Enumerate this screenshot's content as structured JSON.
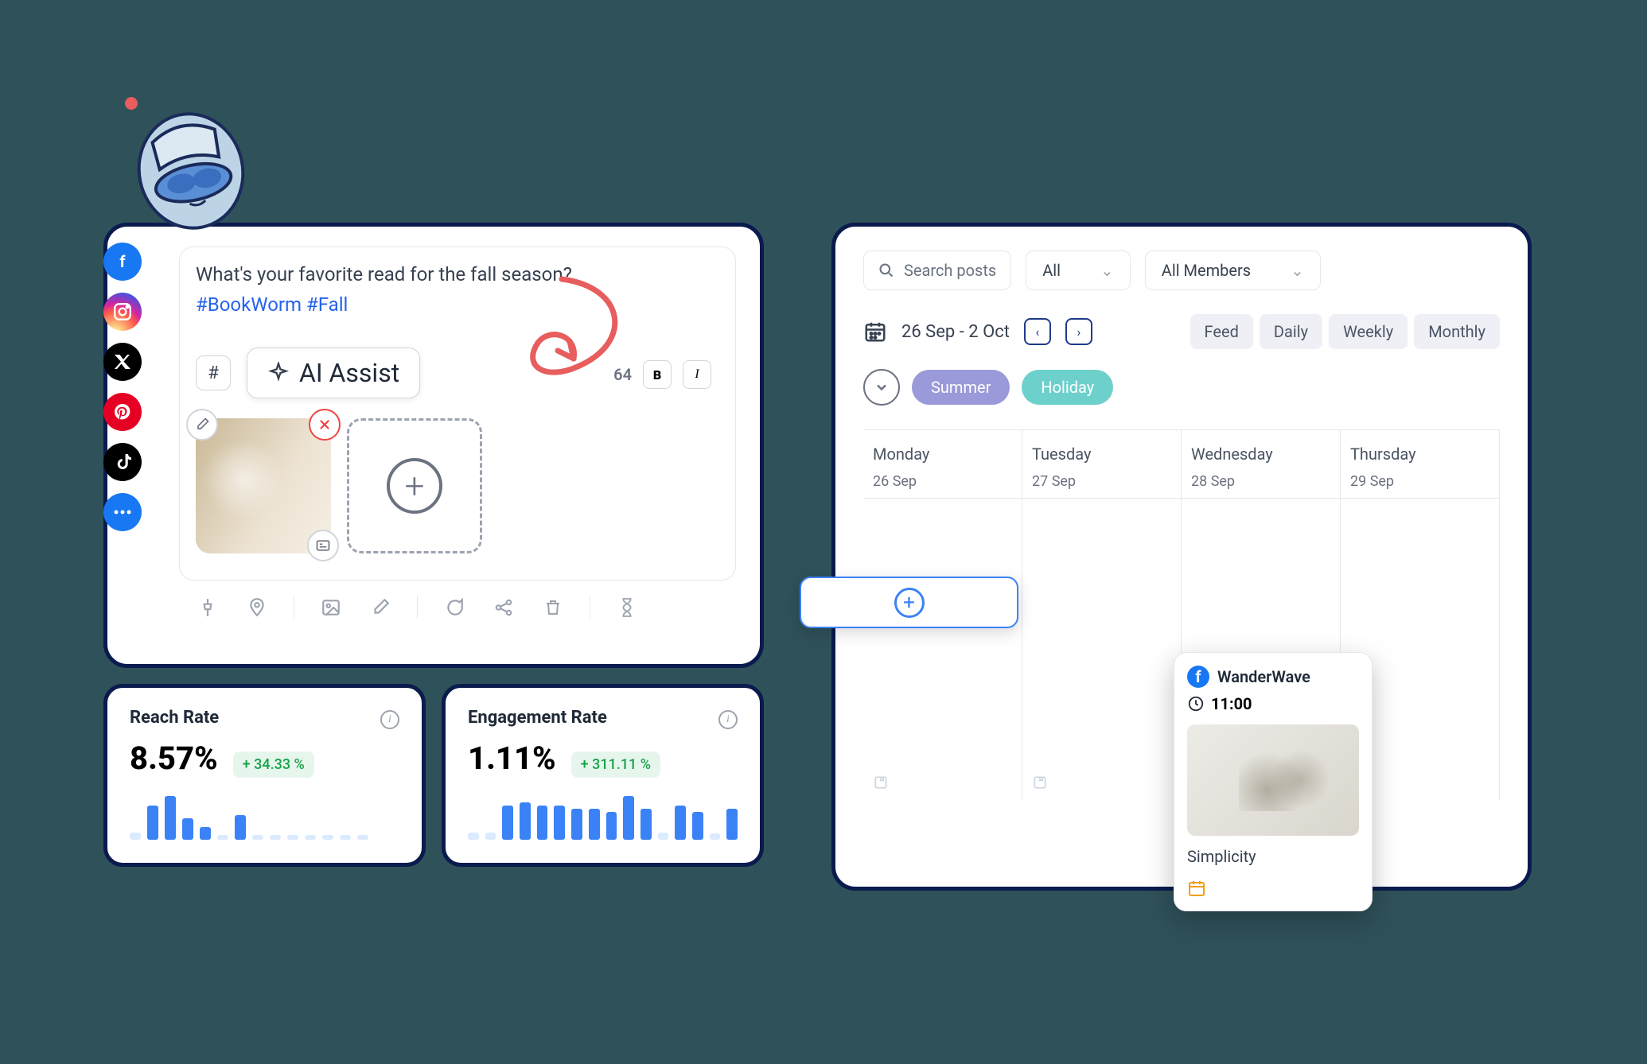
{
  "composer": {
    "text": "What's your favorite read for the fall season?",
    "hashtags": "#BookWorm #Fall",
    "ai_assist_label": "AI Assist",
    "hash_label": "#",
    "char_count": "64",
    "bold_label": "B",
    "italic_label": "I"
  },
  "social_icons": [
    "facebook",
    "instagram",
    "x",
    "pinterest",
    "tiktok",
    "more"
  ],
  "toolbar_icons": [
    "pin",
    "location",
    "image",
    "edit",
    "chat",
    "share",
    "delete",
    "timer"
  ],
  "metrics": {
    "reach": {
      "title": "Reach Rate",
      "value": "8.57%",
      "delta": "+ 34.33 %",
      "bars": [
        12,
        55,
        70,
        35,
        20,
        8,
        40,
        6,
        6,
        6,
        6,
        6,
        6,
        6
      ]
    },
    "engagement": {
      "title": "Engagement Rate",
      "value": "1.11%",
      "delta": "+ 311.11 %",
      "bars": [
        12,
        12,
        55,
        60,
        55,
        55,
        50,
        50,
        45,
        70,
        50,
        12,
        55,
        45,
        10,
        50
      ]
    }
  },
  "calendar": {
    "search_placeholder": "Search posts",
    "filter_all": "All",
    "filter_members": "All Members",
    "date_range": "26 Sep - 2 Oct",
    "views": [
      "Feed",
      "Daily",
      "Weekly",
      "Monthly"
    ],
    "tags": {
      "summer": "Summer",
      "holiday": "Holiday"
    },
    "weekdays": [
      "Monday",
      "Tuesday",
      "Wednesday",
      "Thursday"
    ],
    "dates": [
      "26 Sep",
      "27 Sep",
      "28 Sep",
      "29 Sep"
    ]
  },
  "post_card": {
    "account": "WanderWave",
    "time": "11:00",
    "caption": "Simplicity"
  },
  "chart_data": [
    {
      "type": "bar",
      "title": "Reach Rate",
      "value_label": "8.57%",
      "delta_label": "+ 34.33 %",
      "values": [
        12,
        55,
        70,
        35,
        20,
        8,
        40,
        6,
        6,
        6,
        6,
        6,
        6,
        6
      ],
      "ylim": [
        0,
        80
      ]
    },
    {
      "type": "bar",
      "title": "Engagement Rate",
      "value_label": "1.11%",
      "delta_label": "+ 311.11 %",
      "values": [
        12,
        12,
        55,
        60,
        55,
        55,
        50,
        50,
        45,
        70,
        50,
        12,
        55,
        45,
        10,
        50
      ],
      "ylim": [
        0,
        80
      ]
    }
  ]
}
